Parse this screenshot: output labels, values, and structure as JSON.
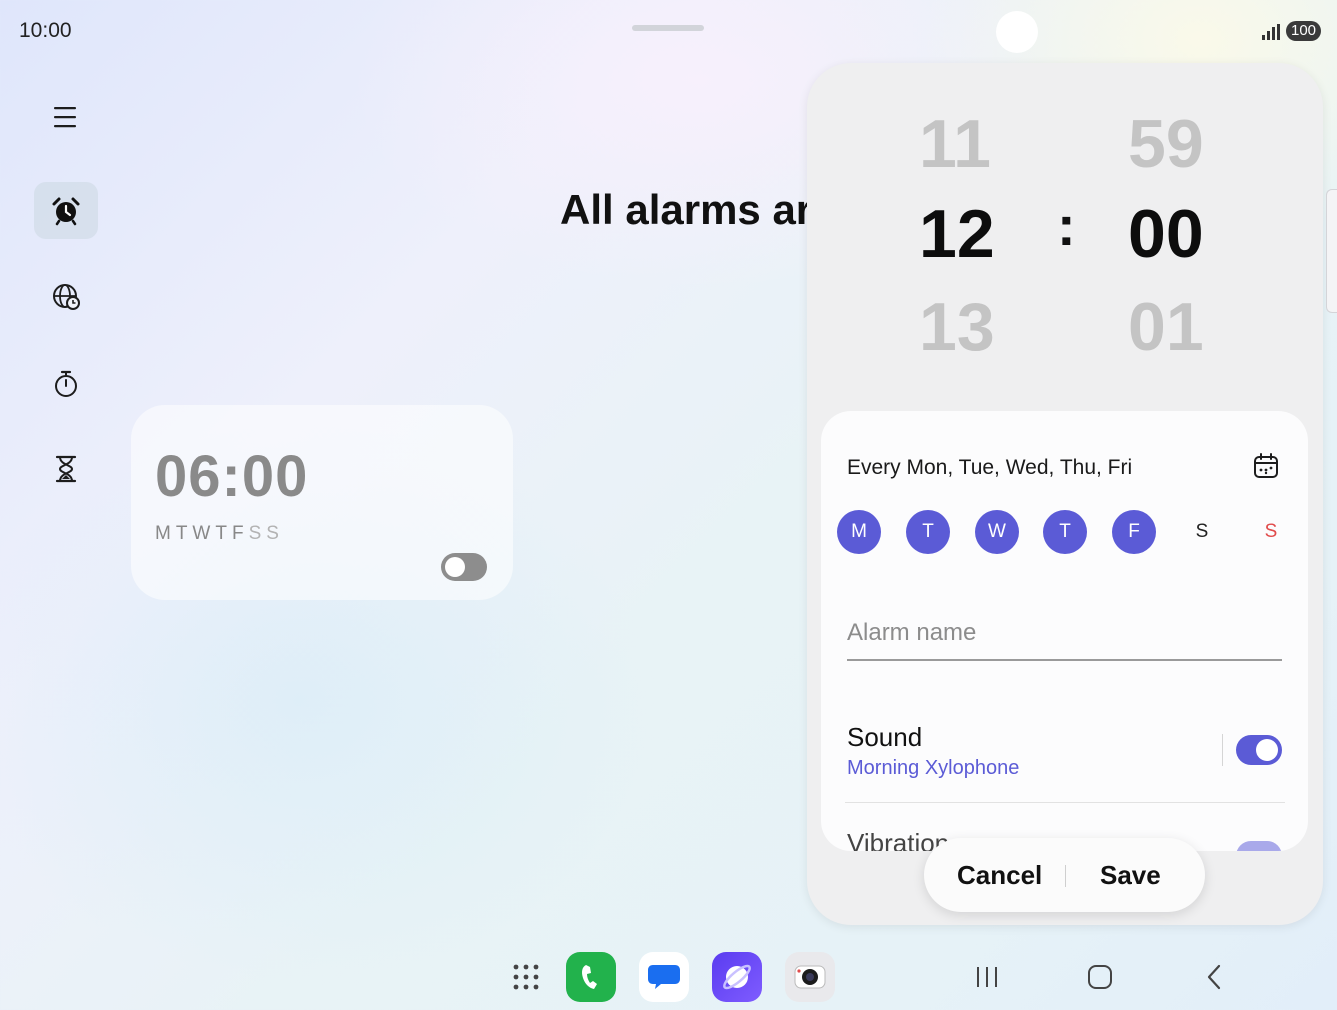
{
  "status_bar": {
    "time": "10:00",
    "battery": "100"
  },
  "nav_rail": {
    "items": [
      {
        "name": "menu",
        "icon": "hamburger-menu-icon"
      },
      {
        "name": "alarm",
        "icon": "alarm-clock-icon",
        "active": true
      },
      {
        "name": "world-clock",
        "icon": "globe-clock-icon"
      },
      {
        "name": "stopwatch",
        "icon": "stopwatch-icon"
      },
      {
        "name": "timer",
        "icon": "hourglass-icon"
      }
    ]
  },
  "main": {
    "heading": "All alarms ar",
    "alarm_card": {
      "time": "06:00",
      "days_weekday": "MTWTF",
      "days_weekend": "SS",
      "enabled": false
    }
  },
  "time_picker": {
    "hours": {
      "prev": "11",
      "selected": "12",
      "next": "13"
    },
    "separator": ":",
    "minutes": {
      "prev": "59",
      "selected": "00",
      "next": "01"
    }
  },
  "settings": {
    "repeat_text": "Every Mon, Tue, Wed, Thu, Fri",
    "days": [
      {
        "label": "M",
        "selected": true
      },
      {
        "label": "T",
        "selected": true
      },
      {
        "label": "W",
        "selected": true
      },
      {
        "label": "T",
        "selected": true
      },
      {
        "label": "F",
        "selected": true
      },
      {
        "label": "S",
        "selected": false
      },
      {
        "label": "S",
        "selected": false,
        "color": "#e14b4b"
      }
    ],
    "alarm_name_placeholder": "Alarm name",
    "alarm_name_value": "",
    "sound": {
      "label": "Sound",
      "value": "Morning Xylophone",
      "enabled": true
    },
    "vibration": {
      "label": "Vibration",
      "enabled": true
    }
  },
  "actions": {
    "cancel": "Cancel",
    "save": "Save"
  },
  "dock": [
    "apps-grid-icon",
    "phone-app-icon",
    "messages-app-icon",
    "internet-app-icon",
    "camera-app-icon"
  ],
  "colors": {
    "accent": "#5b5bd6",
    "sunday": "#e14b4b",
    "phone_green": "#22b24c"
  }
}
